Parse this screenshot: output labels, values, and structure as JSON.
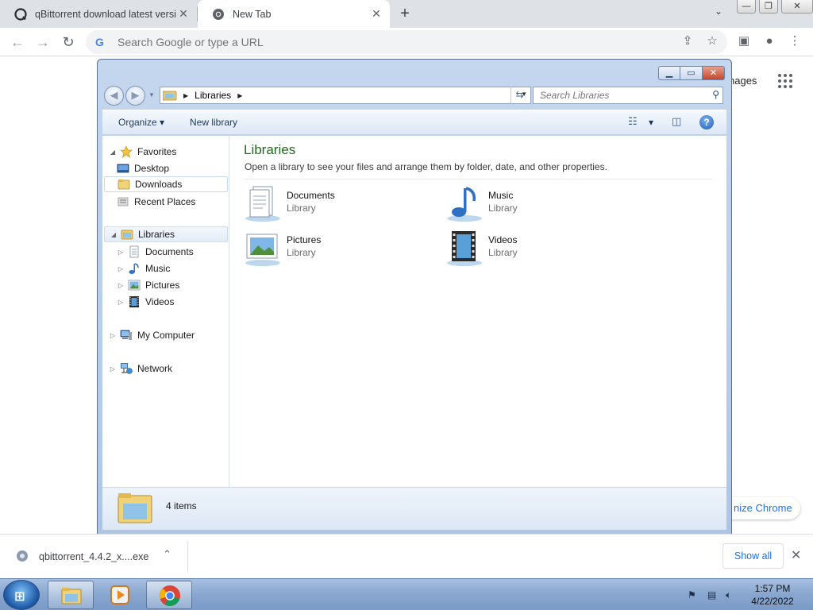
{
  "browser": {
    "tabs": [
      {
        "title": "qBittorrent download latest versi",
        "close": "✕"
      },
      {
        "title": "New Tab",
        "close": "✕"
      }
    ],
    "new_tab": "+",
    "tab_search": "⌄",
    "window_controls": {
      "minimize": "—",
      "maximize": "❐",
      "close": "✕"
    },
    "back": "←",
    "forward": "→",
    "reload": "↻",
    "omnibox_placeholder": "Search Google or type a URL",
    "google_mark": "G"
  },
  "ntp": {
    "images_link": "nages",
    "apps_glyph": "⋮⋮⋮",
    "customize_chrome": "nize Chrome"
  },
  "explorer": {
    "caption_buttons": {
      "minimize": "▁",
      "maximize": "▭",
      "close": "✕"
    },
    "address": {
      "crumb": "Libraries",
      "arrow": "▶",
      "drop": "▼"
    },
    "search_placeholder": "Search Libraries",
    "commands": {
      "organize": "Organize ▾",
      "new_library": "New library",
      "views": "▾"
    },
    "help": "?",
    "nav": {
      "favorites": "Favorites",
      "desktop": "Desktop",
      "downloads": "Downloads",
      "recent_places": "Recent Places",
      "libraries": "Libraries",
      "documents": "Documents",
      "music": "Music",
      "pictures": "Pictures",
      "videos": "Videos",
      "my_computer": "My Computer",
      "network": "Network"
    },
    "content": {
      "title": "Libraries",
      "description": "Open a library to see your files and arrange them by folder, date, and other properties.",
      "items": [
        {
          "name": "Documents",
          "type": "Library"
        },
        {
          "name": "Music",
          "type": "Library"
        },
        {
          "name": "Pictures",
          "type": "Library"
        },
        {
          "name": "Videos",
          "type": "Library"
        }
      ]
    },
    "details": {
      "count": "4 items"
    }
  },
  "download_shelf": {
    "file": "qbittorrent_4.4.2_x....exe",
    "chevron": "⌃",
    "show_all": "Show all",
    "close": "✕"
  },
  "taskbar": {
    "time": "1:57 PM",
    "date": "4/22/2022"
  }
}
